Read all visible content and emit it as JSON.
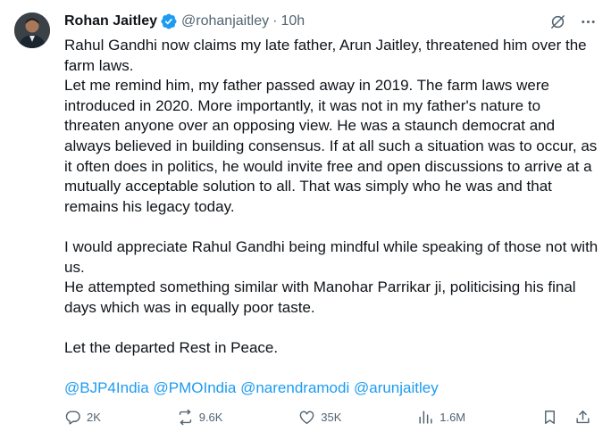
{
  "author": {
    "name": "Rohan Jaitley",
    "handle": "@rohanjaitley",
    "separator": "·",
    "time": "10h"
  },
  "icons": {
    "verified": "verified-badge-icon",
    "grok": "grok-icon",
    "more": "more-options-icon",
    "reply": "reply-icon",
    "repost": "repost-icon",
    "like": "like-icon",
    "views": "views-icon",
    "bookmark": "bookmark-icon",
    "share": "share-icon"
  },
  "colors": {
    "accent": "#1d9bf0",
    "text": "#0f1419",
    "muted": "#536471"
  },
  "tweet": {
    "paragraph_1": "Rahul Gandhi now claims my late father, Arun Jaitley, threatened him over the farm laws.",
    "paragraph_2": "Let me remind him, my father passed away in 2019. The farm laws were introduced in 2020. More importantly, it was not in my father's nature to threaten anyone over an opposing view. He was a staunch democrat and always believed in building consensus. If at all such a situation was to occur, as it often does in politics, he would invite free and open discussions to arrive at a mutually acceptable solution to all. That was simply who he was and that remains his legacy today.",
    "paragraph_3": "I would appreciate Rahul Gandhi being mindful while speaking of those not with us.",
    "paragraph_4": "He attempted something similar with Manohar Parrikar ji, politicising his final days which was in equally poor taste.",
    "paragraph_5": "Let the departed Rest in Peace.",
    "mentions": [
      "@BJP4India",
      "@PMOIndia",
      "@narendramodi",
      "@arunjaitley"
    ]
  },
  "actions": {
    "replies": "2K",
    "reposts": "9.6K",
    "likes": "35K",
    "views": "1.6M"
  }
}
